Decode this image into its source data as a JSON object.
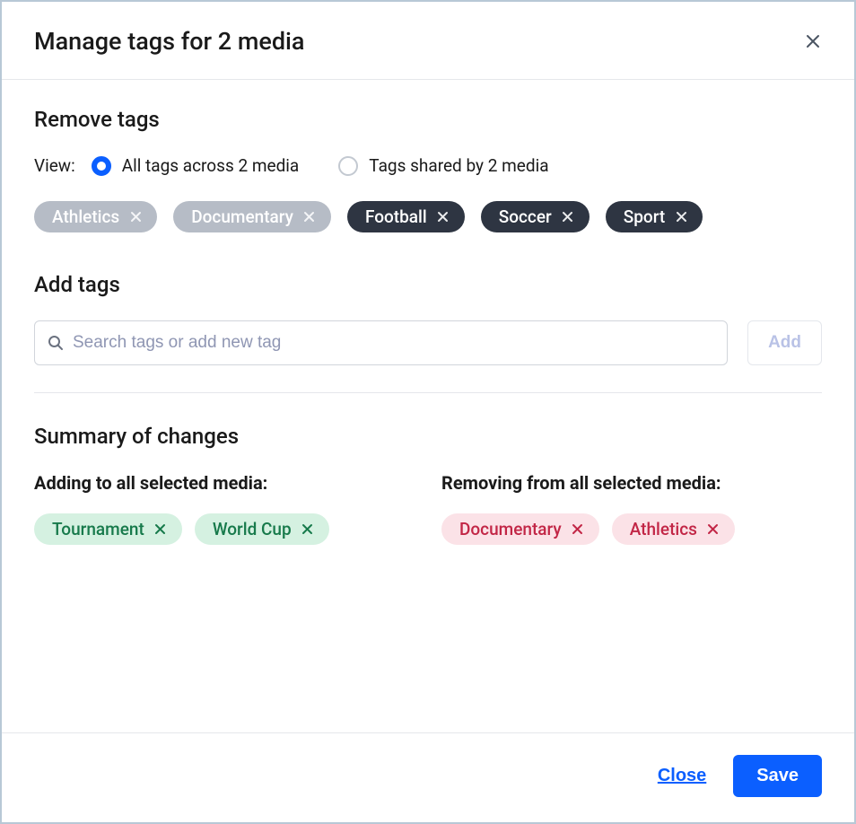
{
  "dialog": {
    "title": "Manage tags for 2 media"
  },
  "remove_section": {
    "title": "Remove tags",
    "view_label": "View:",
    "option_all": "All tags across 2 media",
    "option_shared": "Tags shared by 2 media",
    "tags": [
      {
        "label": "Athletics",
        "variant": "grey"
      },
      {
        "label": "Documentary",
        "variant": "grey"
      },
      {
        "label": "Football",
        "variant": "dark"
      },
      {
        "label": "Soccer",
        "variant": "dark"
      },
      {
        "label": "Sport",
        "variant": "dark"
      }
    ]
  },
  "add_section": {
    "title": "Add tags",
    "search_placeholder": "Search tags or add new tag",
    "add_button": "Add"
  },
  "summary": {
    "title": "Summary of changes",
    "adding_title": "Adding to all selected media:",
    "removing_title": "Removing from all selected media:",
    "adding": [
      {
        "label": "Tournament"
      },
      {
        "label": "World Cup"
      }
    ],
    "removing": [
      {
        "label": "Documentary"
      },
      {
        "label": "Athletics"
      }
    ]
  },
  "footer": {
    "close": "Close",
    "save": "Save"
  }
}
